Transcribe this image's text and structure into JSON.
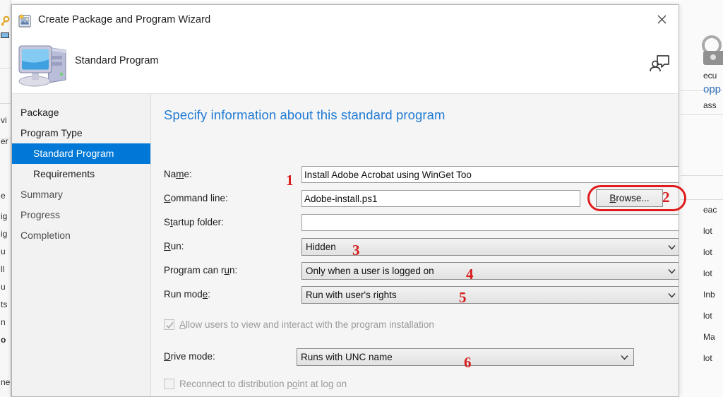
{
  "window": {
    "title": "Create Package and Program Wizard",
    "title_icon": "package-wizard-icon",
    "close_label": "×"
  },
  "banner": {
    "title": "Standard Program",
    "icon": "computer-icon",
    "feedback_icon": "feedback-person-icon"
  },
  "sidebar": {
    "items": [
      {
        "label": "Package",
        "level": "top",
        "selected": false
      },
      {
        "label": "Program Type",
        "level": "top",
        "selected": false
      },
      {
        "label": "Standard Program",
        "level": "sub",
        "selected": true
      },
      {
        "label": "Requirements",
        "level": "sub",
        "selected": false
      },
      {
        "label": "Summary",
        "level": "top",
        "selected": false
      },
      {
        "label": "Progress",
        "level": "top",
        "selected": false
      },
      {
        "label": "Completion",
        "level": "top",
        "selected": false
      }
    ]
  },
  "content": {
    "heading": "Specify information about this standard program",
    "fields": {
      "name": {
        "label_pre": "Na",
        "label_acc": "m",
        "label_post": "e:",
        "value": "Install Adobe Acrobat using WinGet Too",
        "placeholder": ""
      },
      "command_line": {
        "label_pre": "",
        "label_acc": "C",
        "label_post": "ommand line:",
        "value": "Adobe-install.ps1",
        "placeholder": ""
      },
      "startup_folder": {
        "label_pre": "S",
        "label_acc": "t",
        "label_post": "artup folder:",
        "value": "",
        "placeholder": ""
      },
      "run": {
        "label_pre": "",
        "label_acc": "R",
        "label_post": "un:",
        "value": "Hidden"
      },
      "program_can_run": {
        "label_pre": "Program can r",
        "label_acc": "u",
        "label_post": "n:",
        "value": "Only when a user is logged on"
      },
      "run_mode": {
        "label_pre": "Run mod",
        "label_acc": "e",
        "label_post": ":",
        "value": "Run with user's rights"
      },
      "drive_mode": {
        "label_pre": "",
        "label_acc": "D",
        "label_post": "rive mode:",
        "value": "Runs with UNC name"
      }
    },
    "browse_button": "Browse...",
    "browse_acc": "B",
    "checkboxes": {
      "allow_users": {
        "label_pre": "",
        "label_acc": "A",
        "label_post": "llow users to view and interact with the program installation",
        "checked": true,
        "disabled": true
      },
      "reconnect": {
        "label_pre": "Reconnect to distribution p",
        "label_acc": "o",
        "label_post": "int at log on",
        "checked": false,
        "disabled": true
      }
    }
  },
  "annotations": {
    "markers": [
      "1",
      "2",
      "3",
      "4",
      "5",
      "6"
    ]
  },
  "background": {
    "left_fragments": [
      "vi",
      "er",
      "e",
      "ig",
      "ig",
      "u",
      "ll",
      "u",
      "ts",
      "n",
      "o",
      "ne"
    ],
    "right_fragments": [
      "ecu",
      "opp",
      "ass",
      "eac",
      "lot",
      "lot",
      "lot",
      "Inb",
      "lot",
      "Ma",
      "lot"
    ]
  },
  "colors": {
    "accent_blue": "#0078d7",
    "heading_blue": "#1f7ad4",
    "annotation_red": "#d61c1c",
    "dialog_bg": "#f5f5f5"
  }
}
